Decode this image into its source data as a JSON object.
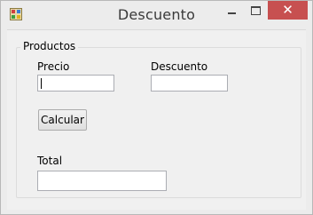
{
  "window": {
    "title": "Descuento",
    "close_glyph": "✕"
  },
  "group": {
    "legend": "Productos"
  },
  "fields": {
    "precio_label": "Precio",
    "precio_value": "",
    "descuento_label": "Descuento",
    "descuento_value": "",
    "total_label": "Total",
    "total_value": ""
  },
  "actions": {
    "calcular_label": "Calcular"
  },
  "colors": {
    "close_button_bg": "#c75050"
  }
}
